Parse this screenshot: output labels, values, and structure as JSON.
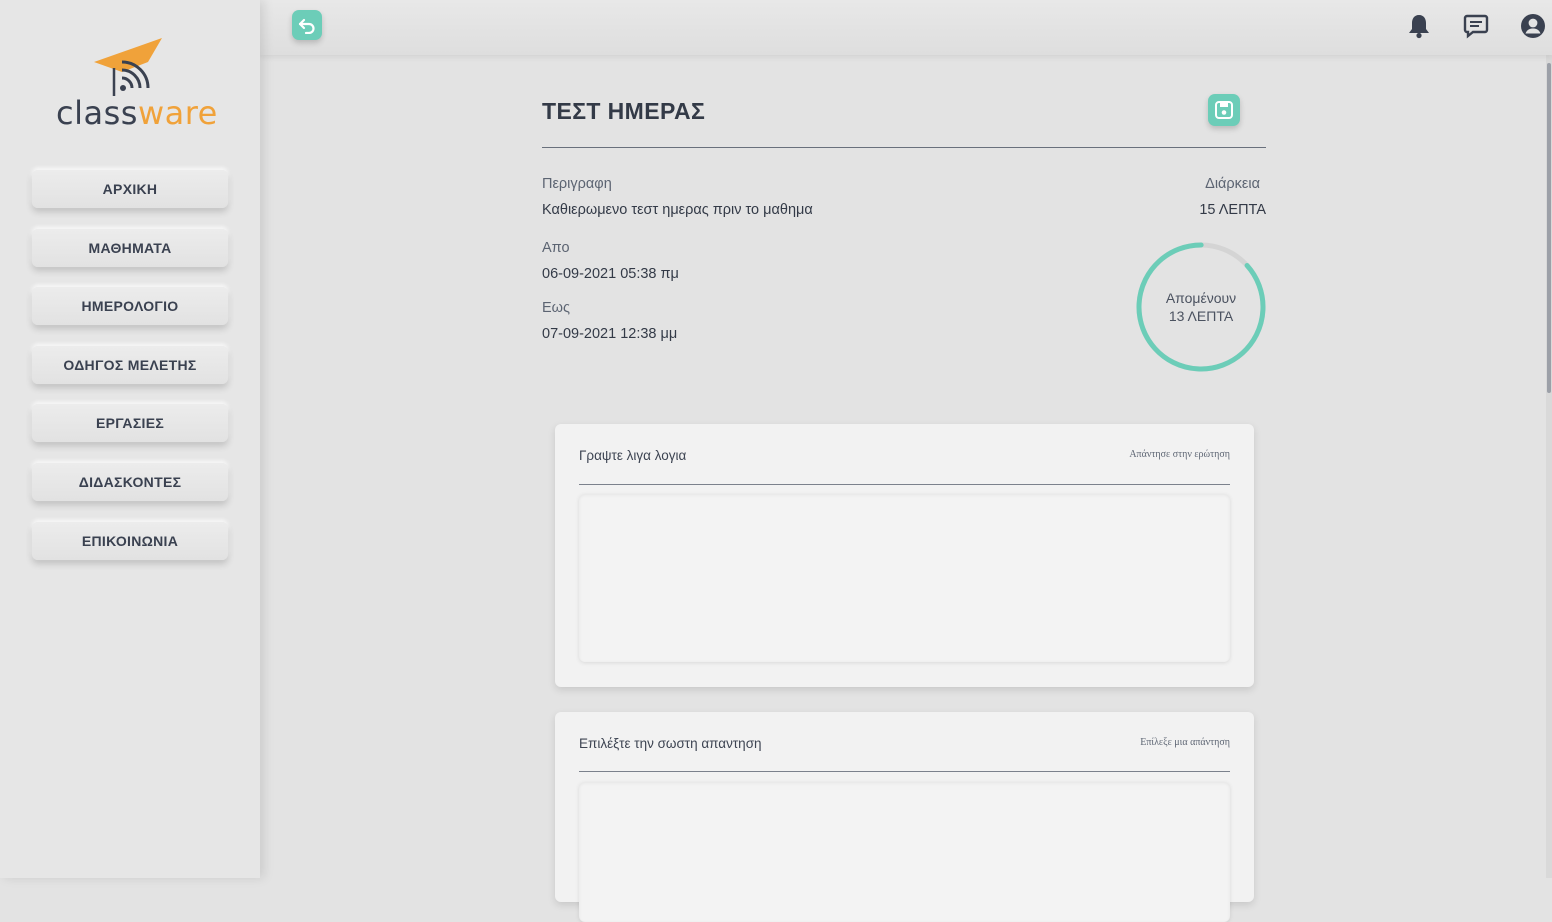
{
  "brand": {
    "logo_part1": "class",
    "logo_part2": "ware",
    "accent": "#f0a23a",
    "teal": "#6ccdb8"
  },
  "sidebar": {
    "items": [
      {
        "label": "ΑΡΧΙΚΗ"
      },
      {
        "label": "ΜΑΘΗΜΑΤΑ"
      },
      {
        "label": "ΗΜΕΡΟΛΟΓΙΟ"
      },
      {
        "label": "ΟΔΗΓΟΣ ΜΕΛΕΤΗΣ"
      },
      {
        "label": "ΕΡΓΑΣΙΕΣ"
      },
      {
        "label": "ΔΙΔΑΣΚΟΝΤΕΣ"
      },
      {
        "label": "ΕΠΙΚΟΙΝΩΝΙΑ"
      }
    ]
  },
  "topbar": {
    "icons": [
      "back-icon",
      "bell-icon",
      "chat-icon",
      "user-icon"
    ]
  },
  "test": {
    "title": "ΤΕΣΤ ΗΜΕΡΑΣ",
    "description_label": "Περιγραφη",
    "description": "Καθιερωμενο τεστ ημερας πριν το μαθημα",
    "from_label": "Απο",
    "from": "06-09-2021 05:38 πμ",
    "to_label": "Εως",
    "to": "07-09-2021 12:38 μμ",
    "duration_label": "Διάρκεια",
    "duration": "15 ΛΕΠΤΑ",
    "timer_line1": "Απομένουν",
    "timer_line2": "13 ΛΕΠΤΑ",
    "remaining_minutes": 13,
    "total_minutes": 15
  },
  "questions": [
    {
      "title": "Γραψτε λιγα λογια",
      "hint": "Απάντησε στην ερώτηση",
      "answer": ""
    },
    {
      "title": "Επιλέξτε την σωστη απαντηση",
      "hint": "Επίλεξε μια απάντηση",
      "answer": ""
    }
  ]
}
